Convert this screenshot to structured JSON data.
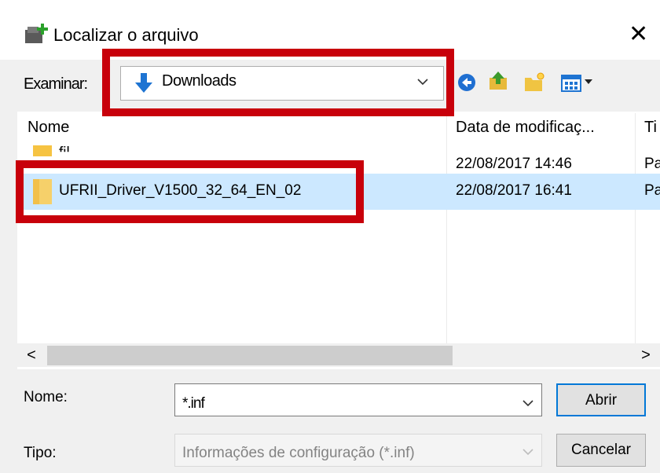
{
  "dialog": {
    "title": "Localizar o arquivo",
    "close_glyph": "✕"
  },
  "location": {
    "label": "Examinar:",
    "value": "Downloads"
  },
  "toolbar": {
    "icons": [
      "back-icon",
      "up-folder-icon",
      "new-folder-icon",
      "view-menu-icon"
    ]
  },
  "file_list": {
    "columns": [
      "Nome",
      "Data de modificaç...",
      "Ti"
    ],
    "rows": [
      {
        "name": "fil",
        "date": "22/08/2017 14:46",
        "type": "Pa",
        "selected": false
      },
      {
        "name": "UFRII_Driver_V1500_32_64_EN_02",
        "date": "22/08/2017 16:41",
        "type": "Pa",
        "selected": true
      }
    ]
  },
  "scrollbar": {
    "left_glyph": "<",
    "right_glyph": ">"
  },
  "filename": {
    "label": "Nome:",
    "value": "*.inf"
  },
  "filetype": {
    "label": "Tipo:",
    "value": "Informações de configuração (*.inf)"
  },
  "buttons": {
    "open": "Abrir",
    "cancel": "Cancelar"
  },
  "colors": {
    "highlight": "#c8000b",
    "selection": "#cce8ff",
    "folder": "#f6c342",
    "accent": "#0078d7"
  }
}
